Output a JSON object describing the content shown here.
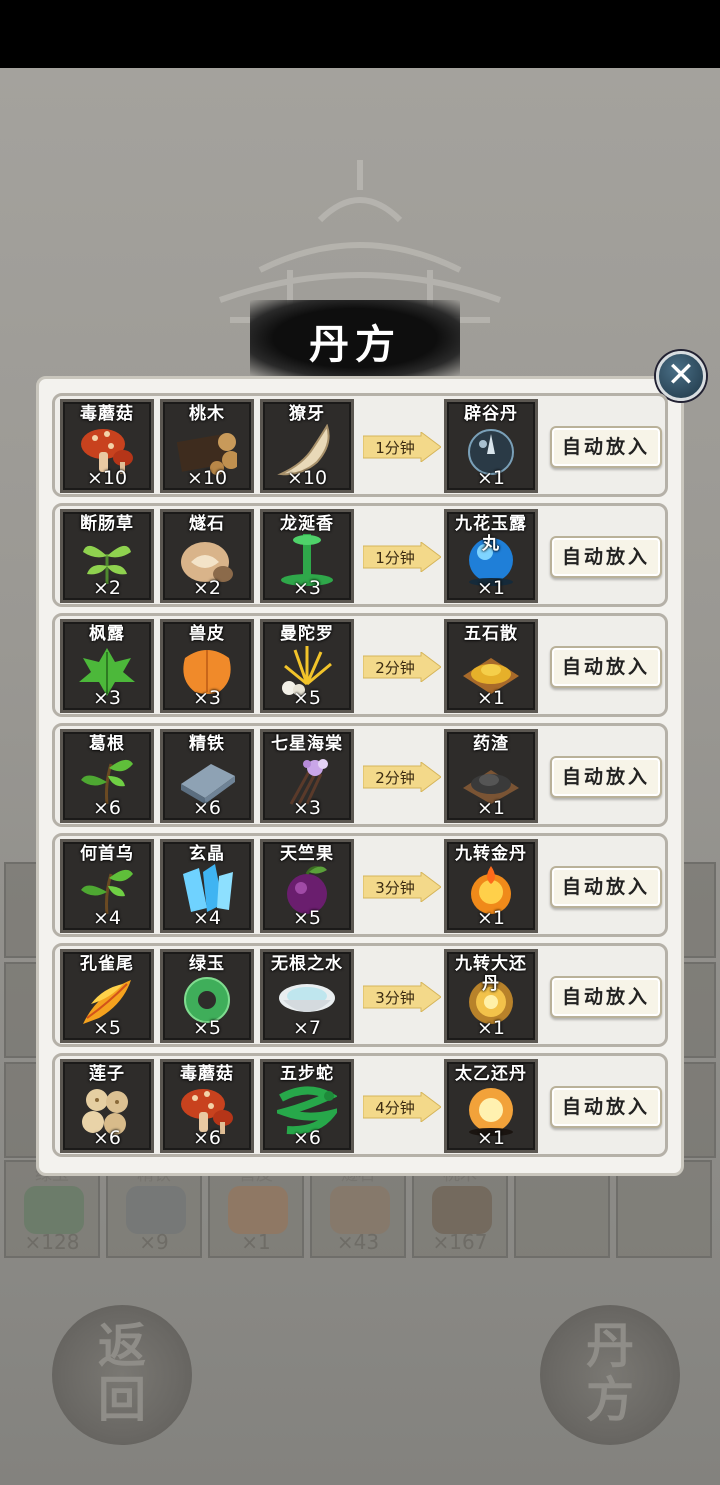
{
  "title": "丹方",
  "close_label": "✕",
  "auto_label": "自动放入",
  "recipes": [
    {
      "ingredients": [
        {
          "name": "毒蘑菇",
          "count": "×10",
          "art": "mushroom"
        },
        {
          "name": "桃木",
          "count": "×10",
          "art": "wood"
        },
        {
          "name": "獠牙",
          "count": "×10",
          "art": "fang"
        }
      ],
      "time": "1分钟",
      "product": {
        "name": "辟谷丹",
        "count": "×1",
        "art": "dark-orb"
      }
    },
    {
      "ingredients": [
        {
          "name": "断肠草",
          "count": "×2",
          "art": "herb"
        },
        {
          "name": "燧石",
          "count": "×2",
          "art": "stone"
        },
        {
          "name": "龙涎香",
          "count": "×3",
          "art": "green-drip"
        }
      ],
      "time": "1分钟",
      "product": {
        "name": "九花玉露丸",
        "count": "×1",
        "art": "blue-orb"
      }
    },
    {
      "ingredients": [
        {
          "name": "枫露",
          "count": "×3",
          "art": "leaf"
        },
        {
          "name": "兽皮",
          "count": "×3",
          "art": "hide"
        },
        {
          "name": "曼陀罗",
          "count": "×5",
          "art": "flower"
        }
      ],
      "time": "2分钟",
      "product": {
        "name": "五石散",
        "count": "×1",
        "art": "powder-yellow"
      }
    },
    {
      "ingredients": [
        {
          "name": "葛根",
          "count": "×6",
          "art": "sprout"
        },
        {
          "name": "精铁",
          "count": "×6",
          "art": "iron"
        },
        {
          "name": "七星海棠",
          "count": "×3",
          "art": "purple-flower"
        }
      ],
      "time": "2分钟",
      "product": {
        "name": "药渣",
        "count": "×1",
        "art": "powder-dark"
      }
    },
    {
      "ingredients": [
        {
          "name": "何首乌",
          "count": "×4",
          "art": "sprout"
        },
        {
          "name": "玄晶",
          "count": "×4",
          "art": "crystal"
        },
        {
          "name": "天竺果",
          "count": "×5",
          "art": "fruit"
        }
      ],
      "time": "3分钟",
      "product": {
        "name": "九转金丹",
        "count": "×1",
        "art": "fire-orb"
      }
    },
    {
      "ingredients": [
        {
          "name": "孔雀尾",
          "count": "×5",
          "art": "feather"
        },
        {
          "name": "绿玉",
          "count": "×5",
          "art": "jade"
        },
        {
          "name": "无根之水",
          "count": "×7",
          "art": "water"
        }
      ],
      "time": "3分钟",
      "product": {
        "name": "九转大还丹",
        "count": "×1",
        "art": "gold-orb"
      }
    },
    {
      "ingredients": [
        {
          "name": "莲子",
          "count": "×6",
          "art": "seeds"
        },
        {
          "name": "毒蘑菇",
          "count": "×6",
          "art": "mushroom"
        },
        {
          "name": "五步蛇",
          "count": "×6",
          "art": "snake"
        }
      ],
      "time": "4分钟",
      "product": {
        "name": "太乙还丹",
        "count": "×1",
        "art": "bright-orb"
      }
    }
  ],
  "background": {
    "inventory": [
      {
        "name": "绿玉",
        "count": "×128"
      },
      {
        "name": "精铁",
        "count": "×9"
      },
      {
        "name": "兽皮",
        "count": "×1"
      },
      {
        "name": "燧石",
        "count": "×43"
      },
      {
        "name": "桃木",
        "count": "×167"
      },
      {
        "name": "",
        "count": ""
      },
      {
        "name": "",
        "count": ""
      }
    ],
    "back_button": "返回",
    "recipe_button": "丹方"
  },
  "colors": {
    "panel": "#f3f2ee",
    "slot": "#2e2c2a",
    "arrow": "#f3d98a",
    "close": "#2c4a5e"
  }
}
